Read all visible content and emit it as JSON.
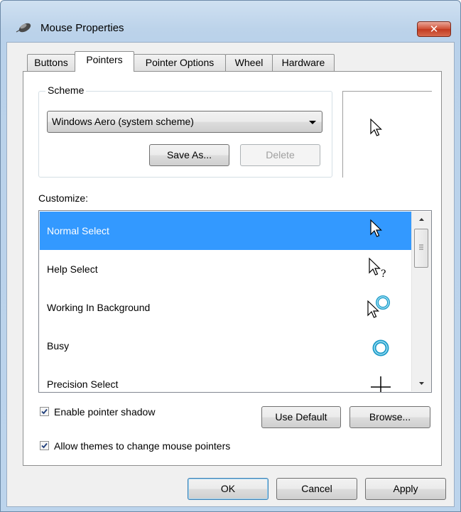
{
  "window": {
    "title": "Mouse Properties",
    "close_glyph": "✕"
  },
  "tabs": [
    {
      "label": "Buttons"
    },
    {
      "label": "Pointers"
    },
    {
      "label": "Pointer Options"
    },
    {
      "label": "Wheel"
    },
    {
      "label": "Hardware"
    }
  ],
  "active_tab": "Pointers",
  "scheme": {
    "label": "Scheme",
    "selected": "Windows Aero (system scheme)",
    "save_as_label": "Save As...",
    "delete_label": "Delete"
  },
  "customize": {
    "label": "Customize:",
    "items": [
      {
        "label": "Normal Select",
        "icon": "arrow-cursor-icon",
        "selected": true
      },
      {
        "label": "Help Select",
        "icon": "help-cursor-icon",
        "selected": false
      },
      {
        "label": "Working In Background",
        "icon": "working-background-cursor-icon",
        "selected": false
      },
      {
        "label": "Busy",
        "icon": "busy-cursor-icon",
        "selected": false
      },
      {
        "label": "Precision Select",
        "icon": "crosshair-cursor-icon",
        "selected": false
      }
    ]
  },
  "options": {
    "enable_shadow_label": "Enable pointer shadow",
    "enable_shadow_checked": true,
    "allow_themes_label": "Allow themes to change mouse pointers",
    "allow_themes_checked": true,
    "use_default_label": "Use Default",
    "browse_label": "Browse..."
  },
  "footer": {
    "ok_label": "OK",
    "cancel_label": "Cancel",
    "apply_label": "Apply"
  },
  "colors": {
    "selection": "#3399ff",
    "titlebar": "#bcd3ea",
    "close": "#c13a20"
  }
}
